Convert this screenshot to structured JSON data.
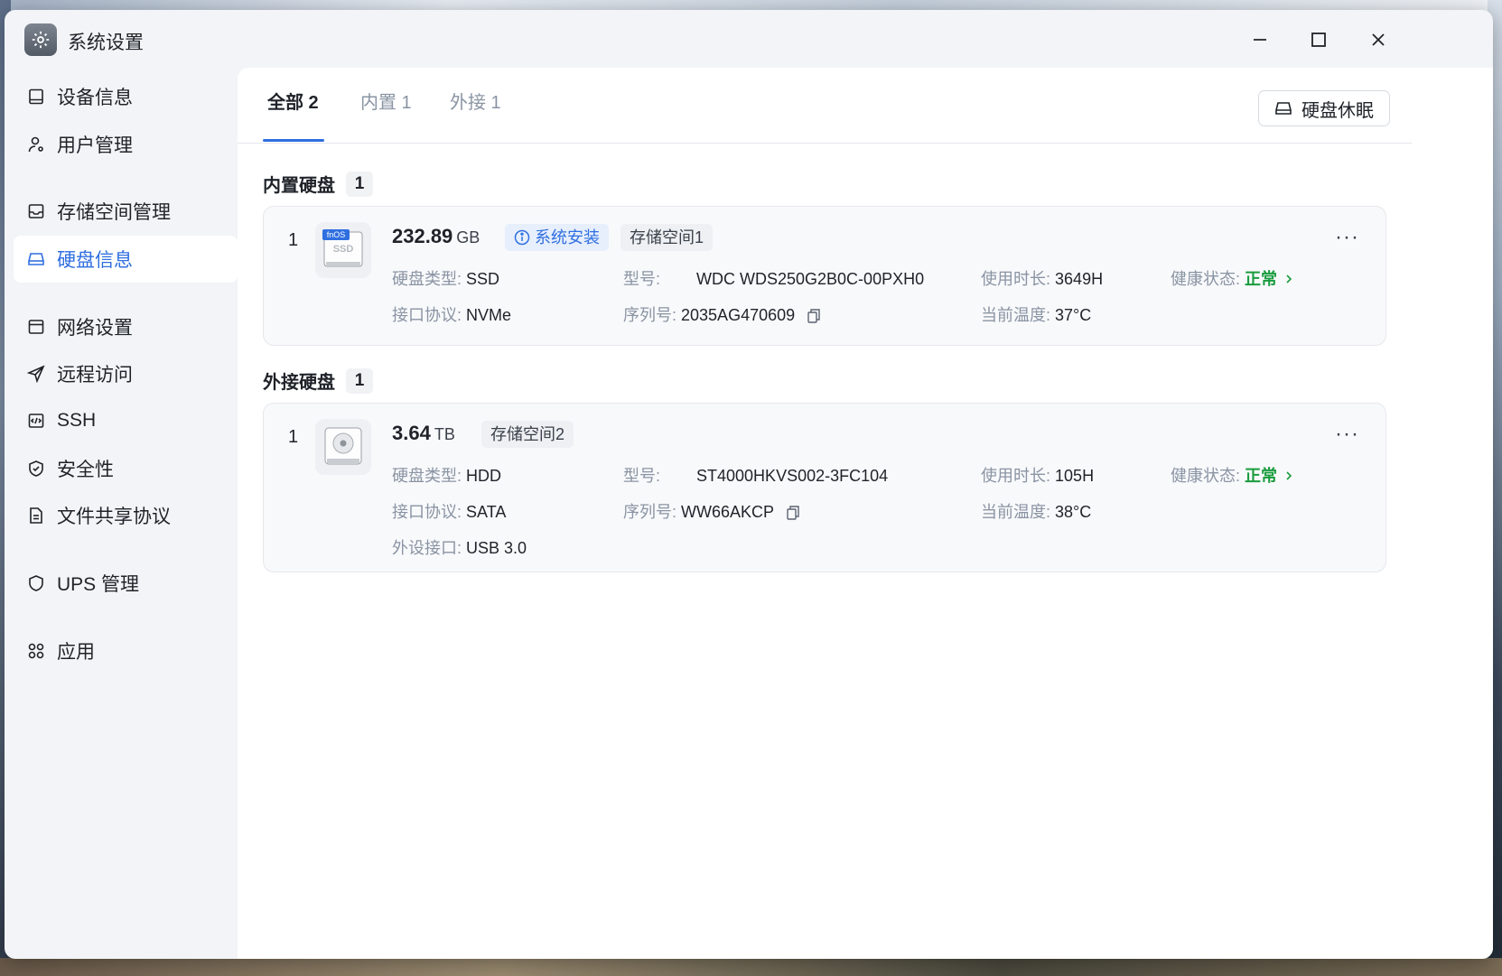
{
  "window": {
    "title": "系统设置"
  },
  "sidebar": {
    "items": [
      {
        "label": "设备信息",
        "icon": "device-icon"
      },
      {
        "label": "用户管理",
        "icon": "user-settings-icon"
      },
      {
        "label": "存储空间管理",
        "icon": "storage-icon"
      },
      {
        "label": "硬盘信息",
        "icon": "disk-icon",
        "active": true
      },
      {
        "label": "网络设置",
        "icon": "network-icon"
      },
      {
        "label": "远程访问",
        "icon": "send-icon"
      },
      {
        "label": "SSH",
        "icon": "code-icon"
      },
      {
        "label": "安全性",
        "icon": "shield-check-icon"
      },
      {
        "label": "文件共享协议",
        "icon": "document-icon"
      },
      {
        "label": "UPS 管理",
        "icon": "shield-icon"
      },
      {
        "label": "应用",
        "icon": "apps-icon"
      }
    ]
  },
  "tabs": [
    {
      "label": "全部 2",
      "active": true
    },
    {
      "label": "内置 1"
    },
    {
      "label": "外接 1"
    }
  ],
  "toolbar": {
    "sleep_label": "硬盘休眠"
  },
  "sections": {
    "internal": {
      "title": "内置硬盘",
      "count": "1"
    },
    "external": {
      "title": "外接硬盘",
      "count": "1"
    }
  },
  "disks": [
    {
      "index": "1",
      "capacity": "232.89",
      "unit": "GB",
      "tag_system": "系统安装",
      "tag_pool": "存储空间1",
      "icon_label": "fnOS",
      "icon_text": "SSD",
      "type_label": "硬盘类型:",
      "type": "SSD",
      "model_label": "型号:",
      "model": "WDC WDS250G2B0C-00PXH0",
      "hours_label": "使用时长:",
      "hours": "3649H",
      "health_label": "健康状态:",
      "health": "正常",
      "iface_label": "接口协议:",
      "iface": "NVMe",
      "serial_label": "序列号:",
      "serial": "2035AG470609",
      "temp_label": "当前温度:",
      "temp": "37°C"
    },
    {
      "index": "1",
      "capacity": "3.64",
      "unit": "TB",
      "tag_pool": "存储空间2",
      "type_label": "硬盘类型:",
      "type": "HDD",
      "model_label": "型号:",
      "model": "ST4000HKVS002-3FC104",
      "hours_label": "使用时长:",
      "hours": "105H",
      "health_label": "健康状态:",
      "health": "正常",
      "iface_label": "接口协议:",
      "iface": "SATA",
      "serial_label": "序列号:",
      "serial": "WW66AKCP",
      "temp_label": "当前温度:",
      "temp": "38°C",
      "port_label": "外设接口:",
      "port": "USB 3.0"
    }
  ],
  "colors": {
    "accent": "#2f6fe0",
    "ok": "#1a9c3e"
  }
}
